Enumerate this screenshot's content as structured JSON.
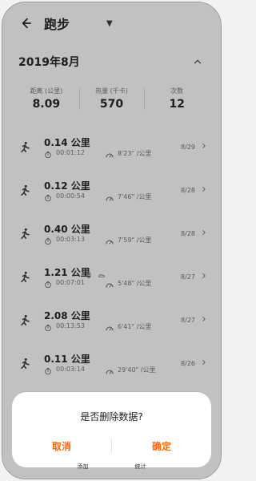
{
  "header": {
    "title": "跑步",
    "dropdown_icon": "▼"
  },
  "summary": {
    "month": "2019年8月",
    "stats": [
      {
        "label": "距离 (公里)",
        "value": "8.09"
      },
      {
        "label": "热量 (千卡)",
        "value": "570"
      },
      {
        "label": "次数",
        "value": "12"
      }
    ]
  },
  "records": [
    {
      "distance": "0.14 公里",
      "duration": "00:01:12",
      "pace": "8'23\" /公里",
      "date": "8/29"
    },
    {
      "distance": "0.12 公里",
      "duration": "00:00:54",
      "pace": "7'46\" /公里",
      "date": "8/28"
    },
    {
      "distance": "0.40 公里",
      "duration": "00:03:13",
      "pace": "7'59\" /公里",
      "date": "8/28"
    },
    {
      "distance": "1.21 公里",
      "duration": "00:07:01",
      "pace": "5'48\" /公里",
      "date": "8/27"
    },
    {
      "distance": "2.08 公里",
      "duration": "00:13:53",
      "pace": "6'41\" /公里",
      "date": "8/27"
    },
    {
      "distance": "0.11 公里",
      "duration": "00:03:14",
      "pace": "29'40\" /公里",
      "date": "8/26"
    }
  ],
  "dialog": {
    "message": "是否删除数据?",
    "cancel": "取消",
    "confirm": "确定"
  },
  "bottom_nav": {
    "left": "添加",
    "right": "统计"
  },
  "colors": {
    "accent": "#ff6a00"
  }
}
